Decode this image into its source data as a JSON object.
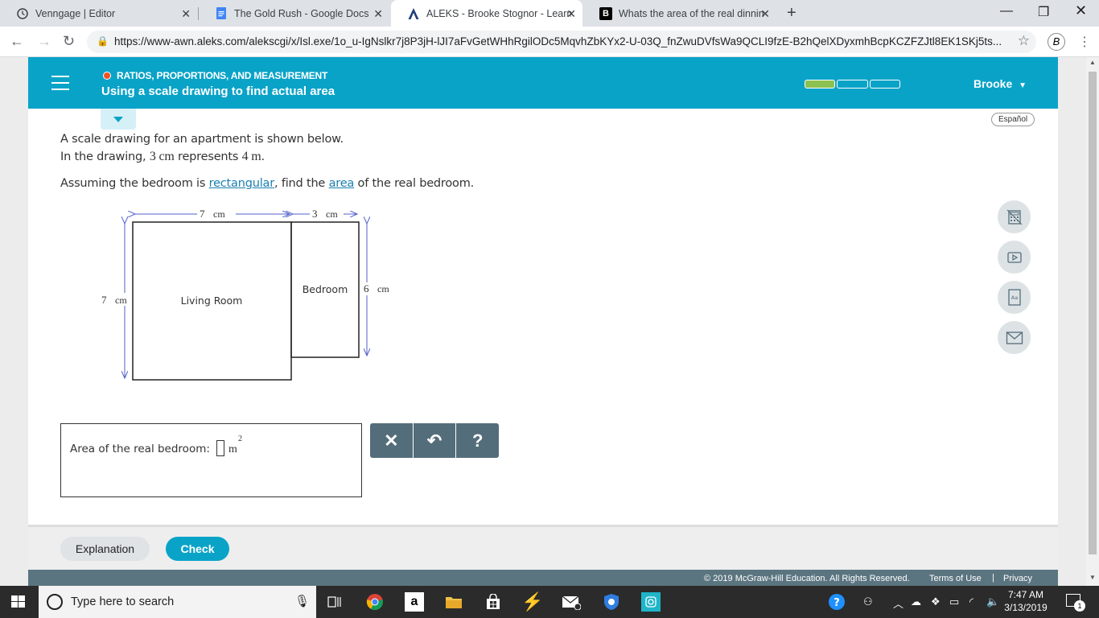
{
  "browser": {
    "tabs": [
      {
        "title": "Venngage | Editor",
        "icon": "clock-icon"
      },
      {
        "title": "The Gold Rush - Google Docs",
        "icon": "docs-icon"
      },
      {
        "title": "ALEKS - Brooke Stognor - Learn",
        "icon": "aleks-icon"
      },
      {
        "title": "Whats the area of the real dinnin",
        "icon": "brainly-icon"
      }
    ],
    "url": "https://www-awn.aleks.com/alekscgi/x/Isl.exe/1o_u-IgNslkr7j8P3jH-lJI7aFvGetWHhRgilODc5MqvhZbKYx2-U-03Q_fnZwuDVfsWa9QCLI9fzE-B2hQelXDyxmhBcpKCZFZJtl8EK1SKj5ts..."
  },
  "header": {
    "topic": "RATIOS, PROPORTIONS, AND MEASUREMENT",
    "lesson": "Using a scale drawing to find actual area",
    "progress": {
      "filled": 1,
      "total": 3
    },
    "user": "Brooke",
    "colors": {
      "header": "#0aa3c8",
      "topic_dot": "#f25022",
      "progress": "#8cc152"
    }
  },
  "language_button": "Español",
  "problem": {
    "line1": "A scale drawing for an apartment is shown below.",
    "line2_prefix": "In the drawing, ",
    "scale_drawing": "3 cm",
    "line2_mid": " represents ",
    "scale_real": "4 m",
    "line2_suffix": ".",
    "line3_prefix": "Assuming the bedroom is ",
    "link_rectangular": "rectangular",
    "line3_mid": ", find the ",
    "link_area": "area",
    "line3_suffix": " of the real bedroom."
  },
  "drawing": {
    "top_label_living": "7",
    "top_label_bedroom": "3",
    "unit": "cm",
    "left_label": "7",
    "right_label": "6",
    "living_room": "Living Room",
    "bedroom": "Bedroom"
  },
  "answer": {
    "label": "Area of the real bedroom:",
    "unit": "m",
    "exponent": "2"
  },
  "keypad": {
    "clear": "✕",
    "undo": "↶",
    "help": "?"
  },
  "tools": [
    "calculator-icon",
    "video-icon",
    "dictionary-icon",
    "mail-icon"
  ],
  "footer": {
    "explanation": "Explanation",
    "check": "Check",
    "copyright": "© 2019 McGraw-Hill Education. All Rights Reserved.",
    "terms": "Terms of Use",
    "separator": "|",
    "privacy": "Privacy"
  },
  "taskbar": {
    "search_placeholder": "Type here to search",
    "time": "7:47 AM",
    "date": "3/13/2019",
    "notification_count": "1"
  }
}
